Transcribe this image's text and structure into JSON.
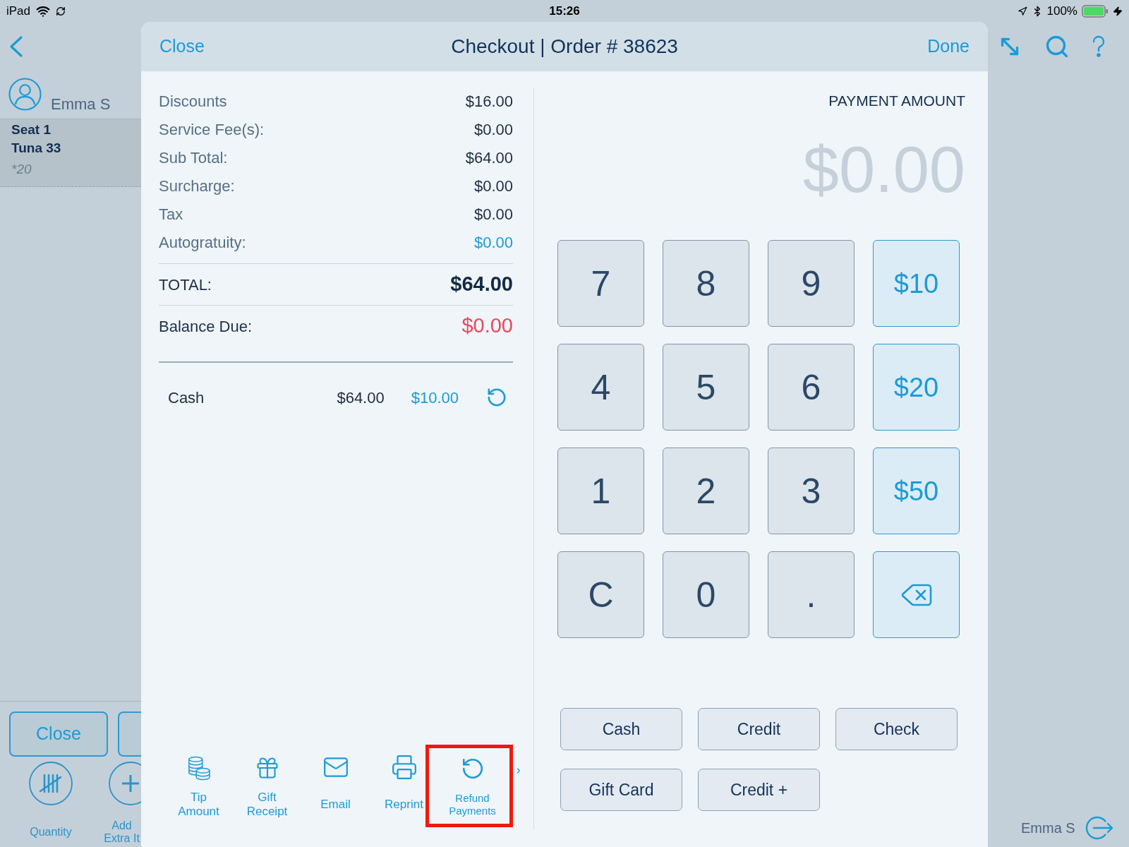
{
  "status_bar": {
    "device": "iPad",
    "time": "15:26",
    "battery": "100%"
  },
  "sidebar": {
    "customer": "Emma S",
    "seat": {
      "title": "Seat 1",
      "item": "Tuna 33",
      "note": "*20"
    },
    "close_button": "Close",
    "actions": [
      {
        "label": "Quantity",
        "kind": "tally"
      },
      {
        "label": "Add\nExtra It",
        "kind": "add"
      }
    ]
  },
  "checkout": {
    "close": "Close",
    "title": "Checkout | Order # 38623",
    "done": "Done",
    "summary": [
      {
        "label": "Discounts",
        "value": "$16.00",
        "kind": "plain"
      },
      {
        "label": "Service Fee(s):",
        "value": "$0.00",
        "kind": "plain"
      },
      {
        "label": "Sub Total:",
        "value": "$64.00",
        "kind": "plain"
      },
      {
        "label": "Surcharge:",
        "value": "$0.00",
        "kind": "plain"
      },
      {
        "label": "Tax",
        "value": "$0.00",
        "kind": "plain"
      },
      {
        "label": "Autogratuity:",
        "value": "$0.00",
        "kind": "link"
      }
    ],
    "total": {
      "label": "TOTAL:",
      "value": "$64.00"
    },
    "balance": {
      "label": "Balance Due:",
      "value": "$0.00"
    },
    "payments": [
      {
        "method": "Cash",
        "amount": "$64.00",
        "tendered": "$10.00"
      }
    ],
    "toolbar": [
      {
        "label": "Tip\nAmount",
        "kind": "coins",
        "highlighted": false
      },
      {
        "label": "Gift\nReceipt",
        "kind": "gift",
        "highlighted": false
      },
      {
        "label": "Email",
        "kind": "mail",
        "highlighted": false
      },
      {
        "label": "Reprint",
        "kind": "printer",
        "highlighted": false
      },
      {
        "label": "Refund\nPayments",
        "kind": "refund",
        "highlighted": true
      }
    ],
    "payment_amount": {
      "label": "PAYMENT AMOUNT",
      "value": "$0.00"
    },
    "keypad": [
      {
        "label": "7",
        "kind": "digit"
      },
      {
        "label": "8",
        "kind": "digit"
      },
      {
        "label": "9",
        "kind": "digit"
      },
      {
        "label": "$10",
        "kind": "preset"
      },
      {
        "label": "4",
        "kind": "digit"
      },
      {
        "label": "5",
        "kind": "digit"
      },
      {
        "label": "6",
        "kind": "digit"
      },
      {
        "label": "$20",
        "kind": "preset"
      },
      {
        "label": "1",
        "kind": "digit"
      },
      {
        "label": "2",
        "kind": "digit"
      },
      {
        "label": "3",
        "kind": "digit"
      },
      {
        "label": "$50",
        "kind": "preset"
      },
      {
        "label": "C",
        "kind": "digit"
      },
      {
        "label": "0",
        "kind": "digit"
      },
      {
        "label": ".",
        "kind": "digit"
      },
      {
        "kind": "backspace"
      }
    ],
    "methods": [
      "Cash",
      "Credit",
      "Check",
      "Gift Card",
      "Credit +"
    ]
  },
  "footer": {
    "user": "Emma S"
  }
}
